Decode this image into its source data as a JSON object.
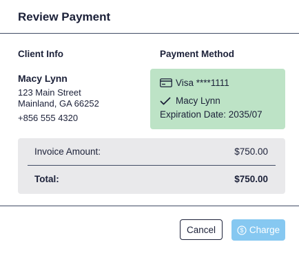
{
  "dialog": {
    "title": "Review Payment"
  },
  "client": {
    "heading": "Client Info",
    "name": "Macy Lynn",
    "address_line1": "123 Main Street",
    "address_line2": "Mainland, GA 66252",
    "phone": "+856 555 4320"
  },
  "payment": {
    "heading": "Payment Method",
    "card": "Visa ****1111",
    "cardholder": "Macy Lynn",
    "expiration": "Expiration Date: 2035/07",
    "card_icon": "credit-card-icon",
    "check_icon": "check-icon"
  },
  "summary": {
    "invoice_label": "Invoice Amount:",
    "invoice_value": "$750.00",
    "total_label": "Total:",
    "total_value": "$750.00"
  },
  "actions": {
    "cancel_label": "Cancel",
    "charge_label": "Charge",
    "charge_icon": "dollar-circle-icon"
  },
  "colors": {
    "payment_box_bg": "#bde3c6",
    "summary_bg": "#e9e9eb",
    "charge_button_bg": "#86c8f1",
    "text": "#1b2038"
  }
}
